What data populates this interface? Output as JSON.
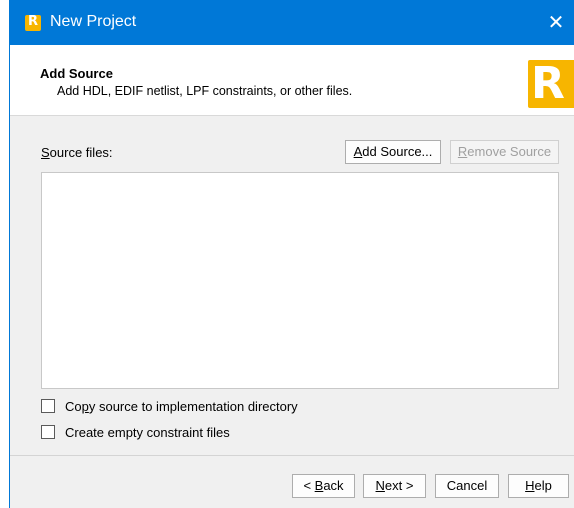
{
  "window": {
    "title": "New Project",
    "app_icon_letter": "R",
    "close_glyph": "✕"
  },
  "header": {
    "title": "Add Source",
    "subtitle": "Add HDL, EDIF netlist, LPF constraints, or other files.",
    "logo_letter": "R"
  },
  "source": {
    "label_accel": "S",
    "label_rest": "ource files:",
    "add_prefix": "",
    "add_accel": "A",
    "add_rest": "dd Source...",
    "remove_accel": "R",
    "remove_rest": "emove Source"
  },
  "options": {
    "copy_pre": "Co",
    "copy_accel": "p",
    "copy_rest": "y source to implementation directory",
    "copy_checked": false,
    "empty_label": "Create empty constraint files",
    "empty_checked": false
  },
  "footer": {
    "back_pre": "< ",
    "back_accel": "B",
    "back_rest": "ack",
    "next_accel": "N",
    "next_rest": "ext >",
    "cancel": "Cancel",
    "help_accel": "H",
    "help_rest": "elp"
  },
  "colors": {
    "titlebar": "#0078d7",
    "brand": "#f7b500"
  }
}
